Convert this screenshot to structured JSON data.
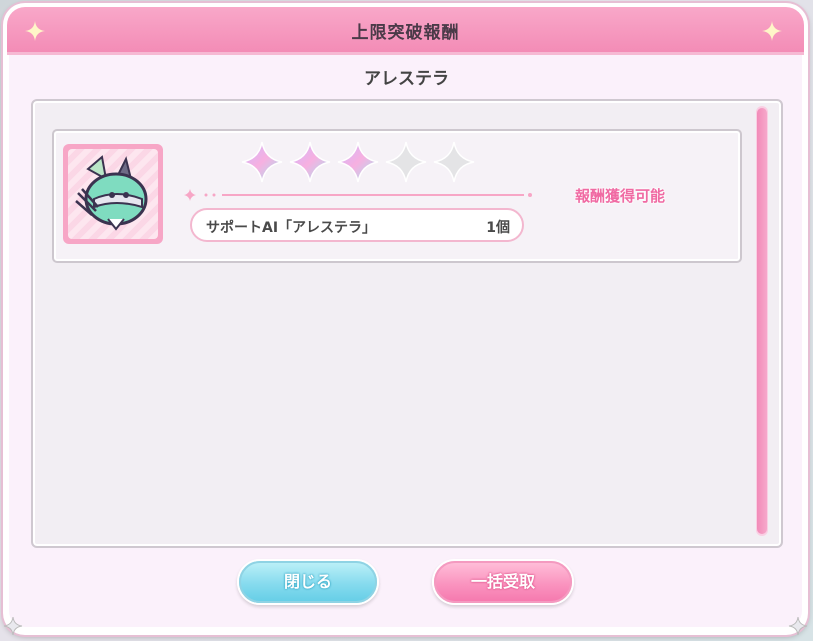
{
  "dialog": {
    "title": "上限突破報酬",
    "subtitle": "アレステラ"
  },
  "reward": {
    "item_name": "サポートAI「アレステラ」",
    "quantity": "1個",
    "status": "報酬獲得可能",
    "stars_filled": 3,
    "stars_total": 5
  },
  "buttons": {
    "close_label": "閉じる",
    "claim_all_label": "一括受取"
  },
  "colors": {
    "accent_pink": "#f38cb6",
    "status_pink": "#f06aa3",
    "close_blue": "#86dbee"
  },
  "icons": {
    "reward_item": "support-ai-creature-icon",
    "rank_star": "sparkle-star-icon"
  }
}
